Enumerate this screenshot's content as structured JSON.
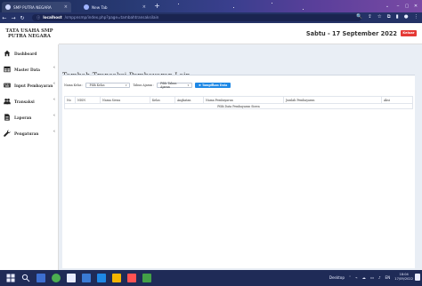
{
  "browser": {
    "tabs": [
      {
        "label": "SMP PUTRA NEGARA",
        "active": true
      },
      {
        "label": "New Tab",
        "active": false
      }
    ],
    "address": {
      "host": "localhost",
      "path": "/smppnsmp/index.php?page=tambahtransaksilain"
    },
    "window_controls": {
      "minimize": "–",
      "maximize": "▢",
      "close": "✕"
    }
  },
  "app": {
    "brand_line1": "TATA USAHA SMP",
    "brand_line2": "PUTRA NEGARA",
    "date": "Sabtu - 17 September 2022",
    "logout_label": "Keluar",
    "colors": {
      "accent": "#1e88e5",
      "danger": "#e53935",
      "content_bg": "#e9eef5"
    }
  },
  "sidebar": {
    "items": [
      {
        "label": "Dashboard",
        "icon": "home-icon",
        "has_submenu": false
      },
      {
        "label": "Master Data",
        "icon": "table-icon",
        "has_submenu": true
      },
      {
        "label": "Input Pembayaran",
        "icon": "keyboard-icon",
        "has_submenu": true
      },
      {
        "label": "Transaksi",
        "icon": "users-icon",
        "has_submenu": true
      },
      {
        "label": "Laporan",
        "icon": "file-icon",
        "has_submenu": true
      },
      {
        "label": "Pengaturan",
        "icon": "wrench-icon",
        "has_submenu": true
      }
    ]
  },
  "main": {
    "title": "Tambah Transaksi Pembayaran Lain",
    "filters": {
      "kelas_label": "Nama Kelas :",
      "kelas_value": "Pilih Kelas",
      "tahun_label": "Tahun Ajaran :",
      "tahun_value": "Pilih Tahun Ajaran",
      "add_button": "Tampilkan Data"
    },
    "table": {
      "columns": [
        "No",
        "NISN",
        "Nama Siswa",
        "Kelas",
        "Angkatan",
        "Nama Pembayaran",
        "Jumlah Pembayaran",
        "Aksi"
      ],
      "empty_text": "Pilih Data Pembayaran Siswa"
    }
  },
  "taskbar": {
    "desktop_label": "Desktop",
    "time": "18:04",
    "date": "17/09/2022"
  }
}
